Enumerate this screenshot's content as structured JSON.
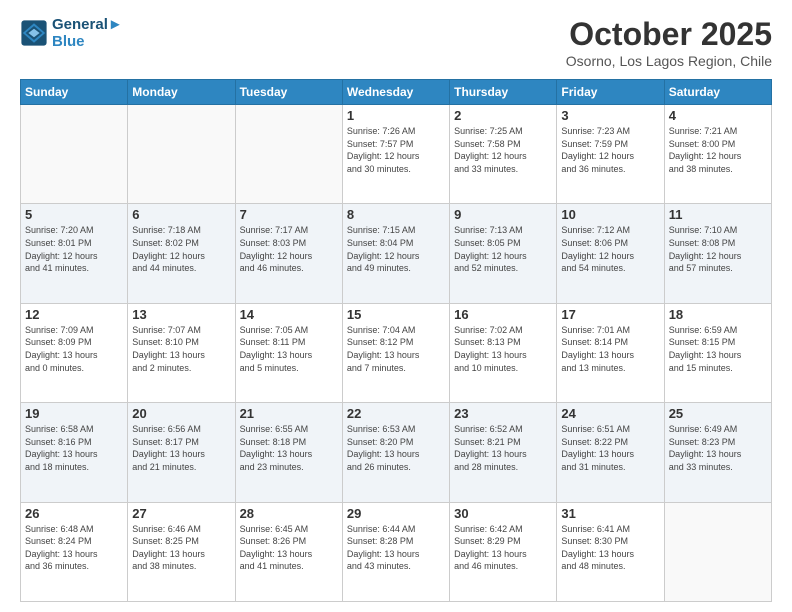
{
  "header": {
    "logo_line1": "General",
    "logo_line2": "Blue",
    "month_title": "October 2025",
    "location": "Osorno, Los Lagos Region, Chile"
  },
  "weekdays": [
    "Sunday",
    "Monday",
    "Tuesday",
    "Wednesday",
    "Thursday",
    "Friday",
    "Saturday"
  ],
  "weeks": [
    [
      {
        "day": "",
        "info": ""
      },
      {
        "day": "",
        "info": ""
      },
      {
        "day": "",
        "info": ""
      },
      {
        "day": "1",
        "info": "Sunrise: 7:26 AM\nSunset: 7:57 PM\nDaylight: 12 hours\nand 30 minutes."
      },
      {
        "day": "2",
        "info": "Sunrise: 7:25 AM\nSunset: 7:58 PM\nDaylight: 12 hours\nand 33 minutes."
      },
      {
        "day": "3",
        "info": "Sunrise: 7:23 AM\nSunset: 7:59 PM\nDaylight: 12 hours\nand 36 minutes."
      },
      {
        "day": "4",
        "info": "Sunrise: 7:21 AM\nSunset: 8:00 PM\nDaylight: 12 hours\nand 38 minutes."
      }
    ],
    [
      {
        "day": "5",
        "info": "Sunrise: 7:20 AM\nSunset: 8:01 PM\nDaylight: 12 hours\nand 41 minutes."
      },
      {
        "day": "6",
        "info": "Sunrise: 7:18 AM\nSunset: 8:02 PM\nDaylight: 12 hours\nand 44 minutes."
      },
      {
        "day": "7",
        "info": "Sunrise: 7:17 AM\nSunset: 8:03 PM\nDaylight: 12 hours\nand 46 minutes."
      },
      {
        "day": "8",
        "info": "Sunrise: 7:15 AM\nSunset: 8:04 PM\nDaylight: 12 hours\nand 49 minutes."
      },
      {
        "day": "9",
        "info": "Sunrise: 7:13 AM\nSunset: 8:05 PM\nDaylight: 12 hours\nand 52 minutes."
      },
      {
        "day": "10",
        "info": "Sunrise: 7:12 AM\nSunset: 8:06 PM\nDaylight: 12 hours\nand 54 minutes."
      },
      {
        "day": "11",
        "info": "Sunrise: 7:10 AM\nSunset: 8:08 PM\nDaylight: 12 hours\nand 57 minutes."
      }
    ],
    [
      {
        "day": "12",
        "info": "Sunrise: 7:09 AM\nSunset: 8:09 PM\nDaylight: 13 hours\nand 0 minutes."
      },
      {
        "day": "13",
        "info": "Sunrise: 7:07 AM\nSunset: 8:10 PM\nDaylight: 13 hours\nand 2 minutes."
      },
      {
        "day": "14",
        "info": "Sunrise: 7:05 AM\nSunset: 8:11 PM\nDaylight: 13 hours\nand 5 minutes."
      },
      {
        "day": "15",
        "info": "Sunrise: 7:04 AM\nSunset: 8:12 PM\nDaylight: 13 hours\nand 7 minutes."
      },
      {
        "day": "16",
        "info": "Sunrise: 7:02 AM\nSunset: 8:13 PM\nDaylight: 13 hours\nand 10 minutes."
      },
      {
        "day": "17",
        "info": "Sunrise: 7:01 AM\nSunset: 8:14 PM\nDaylight: 13 hours\nand 13 minutes."
      },
      {
        "day": "18",
        "info": "Sunrise: 6:59 AM\nSunset: 8:15 PM\nDaylight: 13 hours\nand 15 minutes."
      }
    ],
    [
      {
        "day": "19",
        "info": "Sunrise: 6:58 AM\nSunset: 8:16 PM\nDaylight: 13 hours\nand 18 minutes."
      },
      {
        "day": "20",
        "info": "Sunrise: 6:56 AM\nSunset: 8:17 PM\nDaylight: 13 hours\nand 21 minutes."
      },
      {
        "day": "21",
        "info": "Sunrise: 6:55 AM\nSunset: 8:18 PM\nDaylight: 13 hours\nand 23 minutes."
      },
      {
        "day": "22",
        "info": "Sunrise: 6:53 AM\nSunset: 8:20 PM\nDaylight: 13 hours\nand 26 minutes."
      },
      {
        "day": "23",
        "info": "Sunrise: 6:52 AM\nSunset: 8:21 PM\nDaylight: 13 hours\nand 28 minutes."
      },
      {
        "day": "24",
        "info": "Sunrise: 6:51 AM\nSunset: 8:22 PM\nDaylight: 13 hours\nand 31 minutes."
      },
      {
        "day": "25",
        "info": "Sunrise: 6:49 AM\nSunset: 8:23 PM\nDaylight: 13 hours\nand 33 minutes."
      }
    ],
    [
      {
        "day": "26",
        "info": "Sunrise: 6:48 AM\nSunset: 8:24 PM\nDaylight: 13 hours\nand 36 minutes."
      },
      {
        "day": "27",
        "info": "Sunrise: 6:46 AM\nSunset: 8:25 PM\nDaylight: 13 hours\nand 38 minutes."
      },
      {
        "day": "28",
        "info": "Sunrise: 6:45 AM\nSunset: 8:26 PM\nDaylight: 13 hours\nand 41 minutes."
      },
      {
        "day": "29",
        "info": "Sunrise: 6:44 AM\nSunset: 8:28 PM\nDaylight: 13 hours\nand 43 minutes."
      },
      {
        "day": "30",
        "info": "Sunrise: 6:42 AM\nSunset: 8:29 PM\nDaylight: 13 hours\nand 46 minutes."
      },
      {
        "day": "31",
        "info": "Sunrise: 6:41 AM\nSunset: 8:30 PM\nDaylight: 13 hours\nand 48 minutes."
      },
      {
        "day": "",
        "info": ""
      }
    ]
  ]
}
